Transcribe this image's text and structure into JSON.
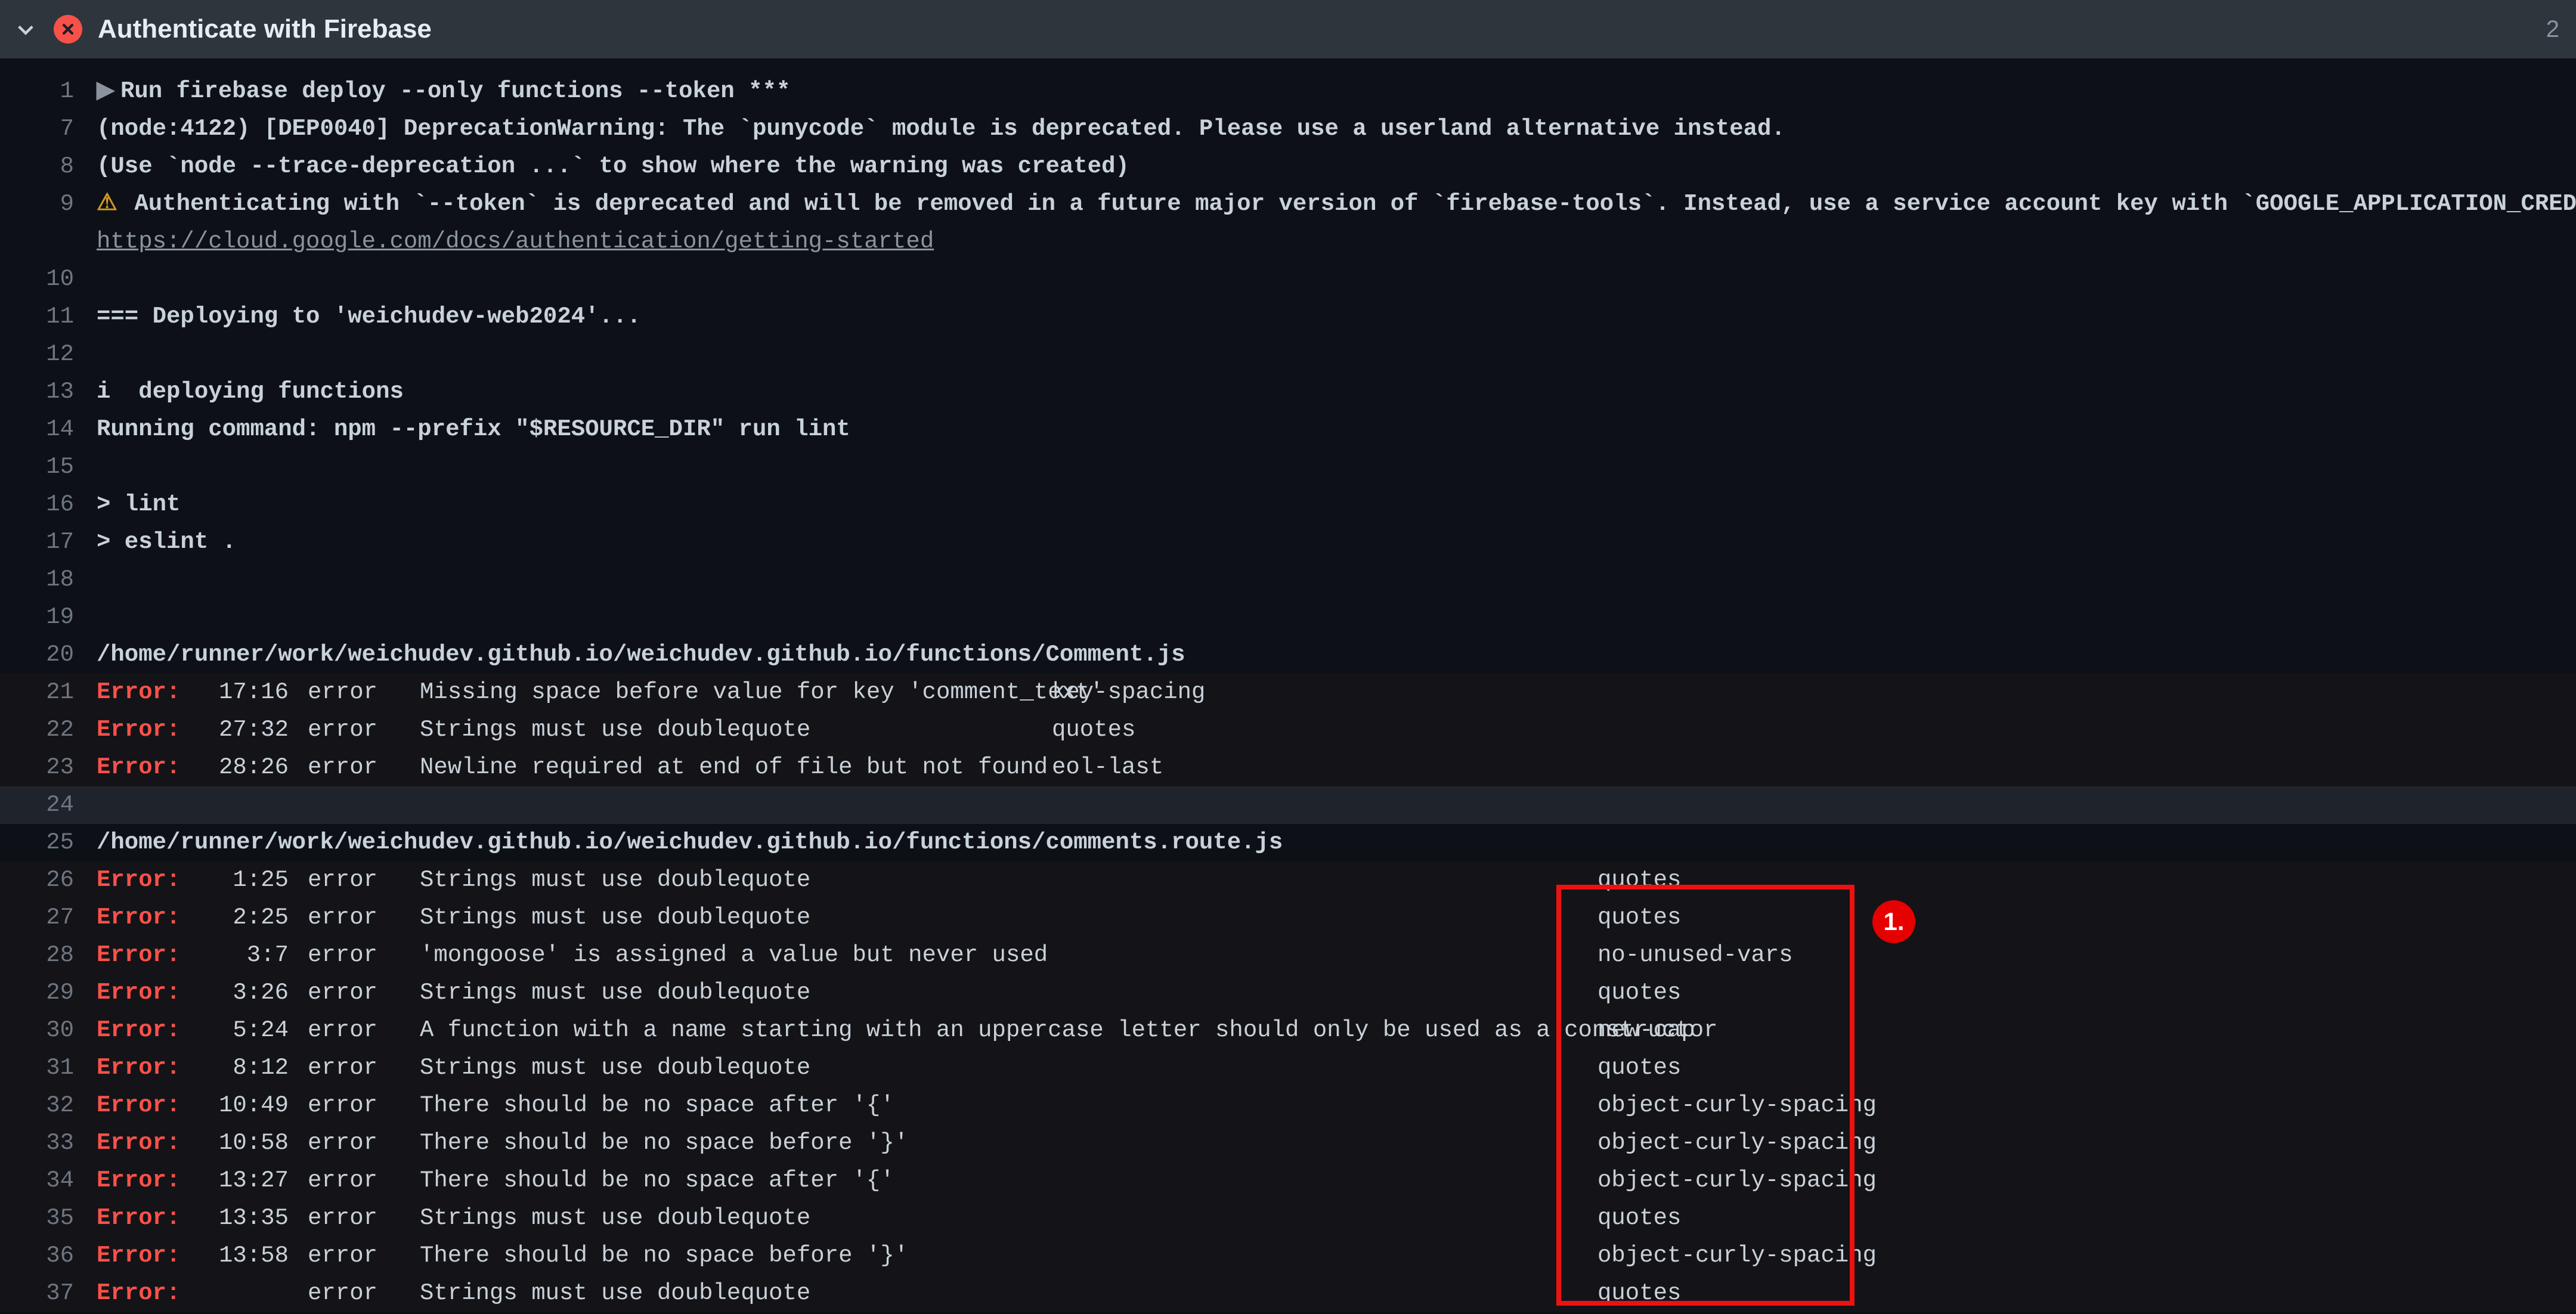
{
  "header": {
    "title": "Authenticate with Firebase",
    "right_hint": "2"
  },
  "lines": {
    "l1": "Run firebase deploy --only functions --token ***",
    "l7": "(node:4122) [DEP0040] DeprecationWarning: The `punycode` module is deprecated. Please use a userland alternative instead.",
    "l8": "(Use `node --trace-deprecation ...` to show where the warning was created)",
    "l9a": " Authenticating with `--token` is deprecated and will be removed in a future major version of `firebase-tools`. Instead, use a service account key with `GOOGLE_APPLICATION_CREDENTIALS`:",
    "l9b": "https://cloud.google.com/docs/authentication/getting-started",
    "l11": "=== Deploying to 'weichudev-web2024'...",
    "l13": "i  deploying functions",
    "l14": "Running command: npm --prefix \"$RESOURCE_DIR\" run lint",
    "l16": "> lint",
    "l17": "> eslint .",
    "l20": "/home/runner/work/weichudev.github.io/weichudev.github.io/functions/Comment.js",
    "l25": "/home/runner/work/weichudev.github.io/weichudev.github.io/functions/comments.route.js"
  },
  "gutter": {
    "n1": "1",
    "n7": "7",
    "n8": "8",
    "n9": "9",
    "n10": "10",
    "n11": "11",
    "n12": "12",
    "n13": "13",
    "n14": "14",
    "n15": "15",
    "n16": "16",
    "n17": "17",
    "n18": "18",
    "n19": "19",
    "n20": "20",
    "n21": "21",
    "n22": "22",
    "n23": "23",
    "n24": "24",
    "n25": "25",
    "n26": "26",
    "n27": "27",
    "n28": "28",
    "n29": "29",
    "n30": "30",
    "n31": "31",
    "n32": "32",
    "n33": "33",
    "n34": "34",
    "n35": "35",
    "n36": "36",
    "n37": "37"
  },
  "sev_label": "Error:",
  "type_label": "error",
  "lint_a": [
    {
      "loc": "17:16",
      "msg": "Missing space before value for key 'comment_text'",
      "rule": "key-spacing"
    },
    {
      "loc": "27:32",
      "msg": "Strings must use doublequote",
      "rule": "quotes"
    },
    {
      "loc": "28:26",
      "msg": "Newline required at end of file but not found",
      "rule": "eol-last"
    }
  ],
  "lint_b": [
    {
      "loc": "1:25",
      "msg": "Strings must use doublequote",
      "rule": "quotes"
    },
    {
      "loc": "2:25",
      "msg": "Strings must use doublequote",
      "rule": "quotes"
    },
    {
      "loc": "3:7",
      "msg": "'mongoose' is assigned a value but never used",
      "rule": "no-unused-vars"
    },
    {
      "loc": "3:26",
      "msg": "Strings must use doublequote",
      "rule": "quotes"
    },
    {
      "loc": "5:24",
      "msg": "A function with a name starting with an uppercase letter should only be used as a constructor",
      "rule": "new-cap"
    },
    {
      "loc": "8:12",
      "msg": "Strings must use doublequote",
      "rule": "quotes"
    },
    {
      "loc": "10:49",
      "msg": "There should be no space after '{'",
      "rule": "object-curly-spacing"
    },
    {
      "loc": "10:58",
      "msg": "There should be no space before '}'",
      "rule": "object-curly-spacing"
    },
    {
      "loc": "13:27",
      "msg": "There should be no space after '{'",
      "rule": "object-curly-spacing"
    },
    {
      "loc": "13:35",
      "msg": "Strings must use doublequote",
      "rule": "quotes"
    },
    {
      "loc": "13:58",
      "msg": "There should be no space before '}'",
      "rule": "object-curly-spacing"
    },
    {
      "loc": "",
      "msg": "Strings must use doublequote",
      "rule": "quotes"
    }
  ],
  "annotation": {
    "label": "1."
  }
}
